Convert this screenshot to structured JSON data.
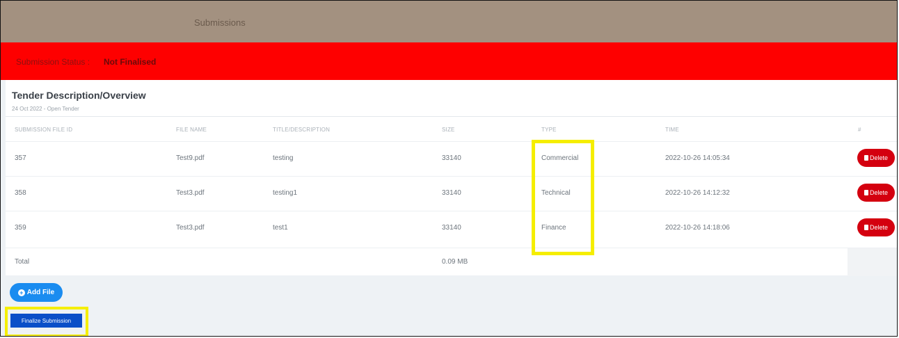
{
  "header": {
    "title": "Submissions"
  },
  "status": {
    "label": "Submission Status :",
    "value": "Not Finalised"
  },
  "card": {
    "title": "Tender Description/Overview",
    "subtitle": "24 Oct 2022 - Open Tender"
  },
  "table": {
    "columns": [
      "Submission File ID",
      "File Name",
      "Title/Description",
      "Size",
      "Type",
      "Time",
      "#"
    ],
    "rows": [
      {
        "id": "357",
        "file": "Test9.pdf",
        "title": "testing",
        "size": "33140",
        "type": "Commercial",
        "time": "2022-10-26 14:05:34",
        "action": "Delete"
      },
      {
        "id": "358",
        "file": "Test3.pdf",
        "title": "testing1",
        "size": "33140",
        "type": "Technical",
        "time": "2022-10-26 14:12:32",
        "action": "Delete"
      },
      {
        "id": "359",
        "file": "Test3.pdf",
        "title": "test1",
        "size": "33140",
        "type": "Finance",
        "time": "2022-10-26 14:18:06",
        "action": "Delete"
      }
    ],
    "total": {
      "label": "Total",
      "value": "0.09 MB"
    }
  },
  "buttons": {
    "add_file": "Add File",
    "finalize": "Finalize Submission"
  },
  "colors": {
    "header_bg": "#a39180",
    "status_bg": "#fe0000",
    "delete": "#d4000f",
    "add": "#1a8cf0",
    "finalize": "#0a4fc8",
    "highlight": "#f5ee00"
  }
}
